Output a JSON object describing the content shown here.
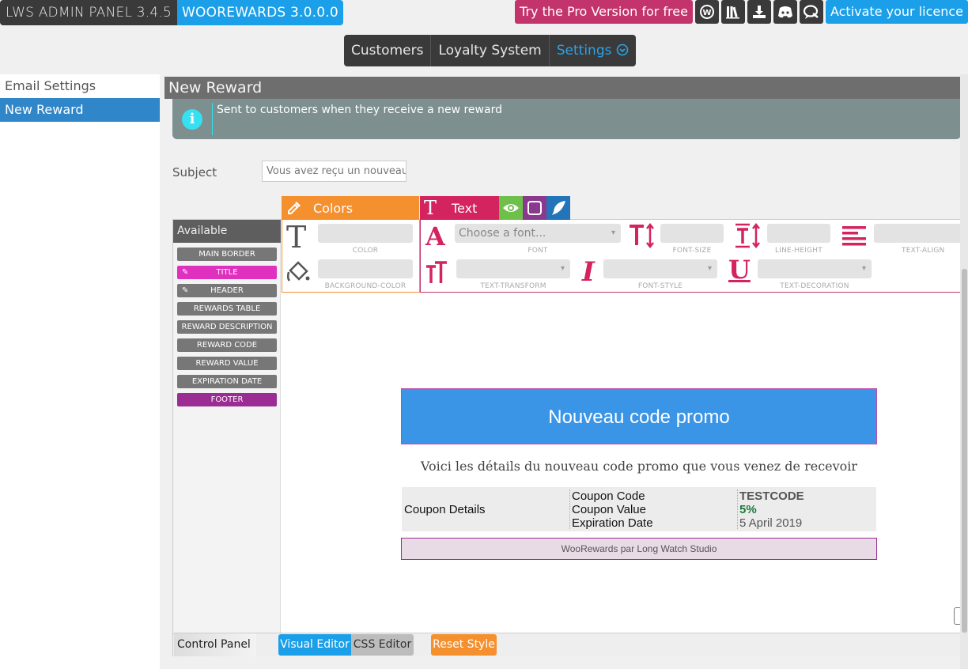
{
  "topbar": {
    "admin_panel": "LWS ADMIN PANEL 3.4.5",
    "woorewards": "WOOREWARDS 3.0.0.0",
    "pro_link": "Try the Pro Version for free",
    "licence_link": "Activate your licence",
    "icons": [
      "wordpress-icon",
      "library-icon",
      "download-icon",
      "discord-icon",
      "support-chat-icon"
    ]
  },
  "mainnav": {
    "customers": "Customers",
    "loyalty": "Loyalty System",
    "settings": "Settings"
  },
  "sidebar": {
    "items": [
      {
        "label": "Email Settings"
      },
      {
        "label": "New Reward"
      }
    ]
  },
  "section": {
    "title": "New Reward",
    "info": "Sent to customers when they receive a new reward"
  },
  "subject": {
    "label": "Subject",
    "value": "Vous avez reçu un nouveau"
  },
  "elements": {
    "header": "Available Elements",
    "items": [
      "MAIN BORDER",
      "TITLE",
      "HEADER",
      "REWARDS TABLE",
      "REWARD DESCRIPTION",
      "REWARD CODE",
      "REWARD VALUE",
      "EXPIRATION DATE",
      "FOOTER"
    ]
  },
  "tabs": {
    "colors": "Colors",
    "text": "Text"
  },
  "colors_panel": {
    "color_label": "COLOR",
    "bg_label": "BACKGROUND-COLOR"
  },
  "text_panel": {
    "font_placeholder": "Choose a font...",
    "font_label": "FONT",
    "size_label": "FONT-SIZE",
    "lineheight_label": "LINE-HEIGHT",
    "align_label": "TEXT-ALIGN",
    "transform_label": "TEXT-TRANSFORM",
    "style_label": "FONT-STYLE",
    "decoration_label": "TEXT-DECORATION"
  },
  "email": {
    "title": "Nouveau code promo",
    "description": "Voici les détails du nouveau code promo que vous venez de recevoir",
    "details_label": "Coupon Details",
    "rows": [
      {
        "key": "Coupon Code",
        "value": "TESTCODE"
      },
      {
        "key": "Coupon Value",
        "value": "5%"
      },
      {
        "key": "Expiration Date",
        "value": "5 April 2019"
      }
    ],
    "footer": "WooRewards par Long Watch Studio"
  },
  "bottom": {
    "control_panel": "Control Panel",
    "visual_editor": "Visual Editor",
    "css_editor": "CSS Editor",
    "reset": "Reset Style"
  },
  "colors": {
    "accent_blue": "#1a9fe8",
    "pro_pink": "#c2346b",
    "orange": "#f5902e",
    "text_red": "#d4245f"
  }
}
